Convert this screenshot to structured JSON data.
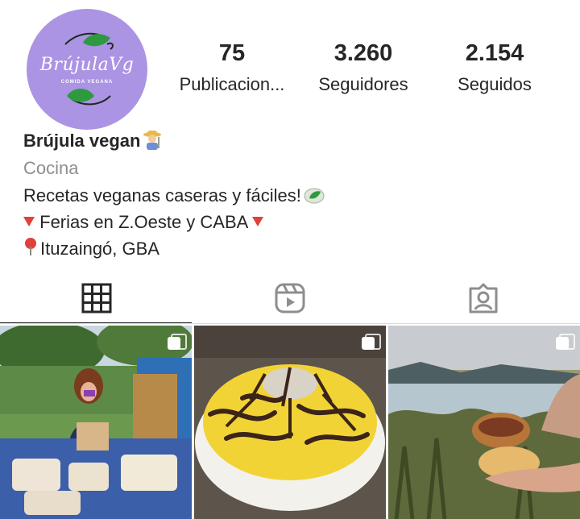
{
  "profile": {
    "avatar_logo_text": "BrújulaVg",
    "avatar_logo_subtext": "COMIDA VEGANA",
    "name": "Brújula vegan",
    "category": "Cocina",
    "bio_line1": "Recetas veganas caseras y fáciles!",
    "bio_line2": "Ferias en Z.Oeste y CABA",
    "bio_line3": "Ituzaingó, GBA"
  },
  "stats": [
    {
      "value": "75",
      "label": "Publicacion..."
    },
    {
      "value": "3.260",
      "label": "Seguidores"
    },
    {
      "value": "2.154",
      "label": "Seguidos"
    }
  ],
  "tabs": [
    {
      "icon": "grid-icon",
      "active": true
    },
    {
      "icon": "reels-icon",
      "active": false
    },
    {
      "icon": "tagged-icon",
      "active": false
    }
  ],
  "colors": {
    "avatar_bg": "#ab94e3",
    "leaf_green": "#2e9a3f",
    "category_gray": "#8e8e8e",
    "pin_red": "#e0413b"
  }
}
